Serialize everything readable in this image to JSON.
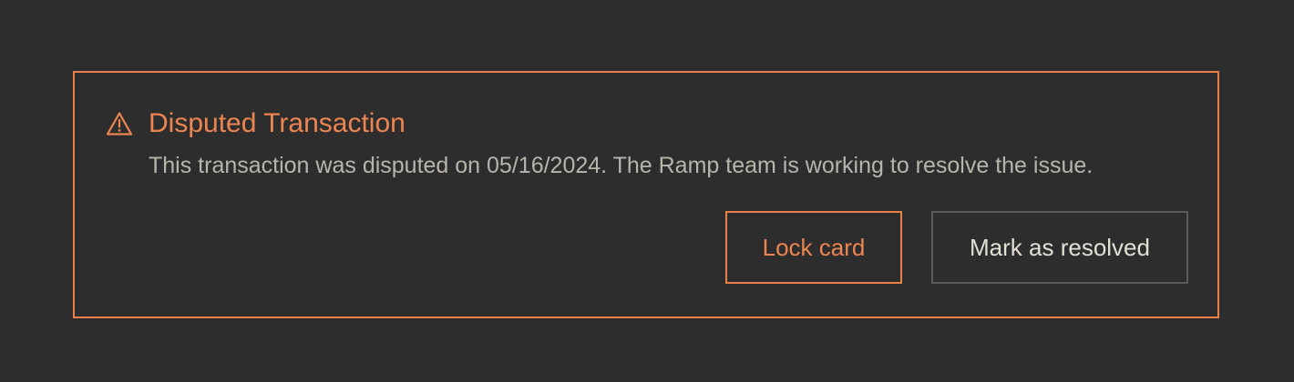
{
  "alert": {
    "icon": "warning-triangle-icon",
    "title": "Disputed Transaction",
    "message": "This transaction was disputed on 05/16/2024. The Ramp team is working to resolve the issue.",
    "buttons": {
      "lock_card": "Lock card",
      "mark_resolved": "Mark as resolved"
    }
  },
  "colors": {
    "background": "#2d2d2d",
    "accent": "#e8804a",
    "message_text": "#b7b5ab",
    "secondary_button_border": "#5b5b58",
    "secondary_button_text": "#e2e0d5"
  }
}
